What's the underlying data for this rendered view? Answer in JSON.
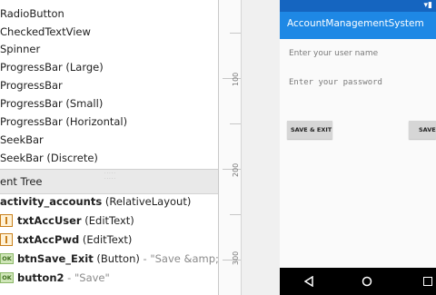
{
  "palette": {
    "items": [
      "RadioButton",
      "CheckedTextView",
      "Spinner",
      "ProgressBar (Large)",
      "ProgressBar",
      "ProgressBar (Small)",
      "ProgressBar (Horizontal)",
      "SeekBar",
      "SeekBar (Discrete)"
    ]
  },
  "component_tree": {
    "header": "ent Tree",
    "root": {
      "name": "activity_accounts",
      "type": "(RelativeLayout)"
    },
    "children": [
      {
        "icon": "edittext-icon",
        "name": "txtAccUser",
        "type": "(EditText)",
        "extra": ""
      },
      {
        "icon": "edittext-icon",
        "name": "txtAccPwd",
        "type": "(EditText)",
        "extra": ""
      },
      {
        "icon": "button-icon",
        "icon_text": "OK",
        "name": "btnSave_Exit",
        "type": "(Button)",
        "extra": "- \"Save &amp; Exit\""
      },
      {
        "icon": "button-icon",
        "icon_text": "OK",
        "name": "button2",
        "type": "",
        "extra": "- \"Save\""
      }
    ]
  },
  "ruler": {
    "labels": [
      "100",
      "200",
      "300"
    ]
  },
  "preview": {
    "app_title": "AccountManagementSystem",
    "username_hint": "Enter your user name",
    "password_hint": "Enter your password",
    "button_save_exit": "SAVE & EXIT",
    "button_save": "SAVE",
    "colors": {
      "status_bar": "#1565c0",
      "app_bar": "#1e88e5",
      "nav_bar": "#000000"
    }
  }
}
